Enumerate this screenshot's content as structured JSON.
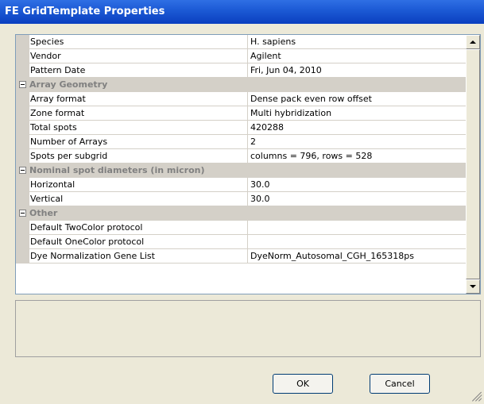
{
  "window": {
    "title": "FE GridTemplate Properties"
  },
  "grid": {
    "rows": [
      {
        "kind": "prop",
        "name": "Species",
        "value": "H. sapiens"
      },
      {
        "kind": "prop",
        "name": "Vendor",
        "value": "Agilent"
      },
      {
        "kind": "prop",
        "name": "Pattern Date",
        "value": "Fri, Jun 04, 2010"
      },
      {
        "kind": "category",
        "name": "Array Geometry"
      },
      {
        "kind": "prop",
        "name": "Array format",
        "value": "Dense pack even row offset"
      },
      {
        "kind": "prop",
        "name": "Zone format",
        "value": "Multi hybridization"
      },
      {
        "kind": "prop",
        "name": "Total spots",
        "value": "420288"
      },
      {
        "kind": "prop",
        "name": "Number of Arrays",
        "value": "2"
      },
      {
        "kind": "prop",
        "name": "Spots per subgrid",
        "value": "columns = 796,  rows = 528"
      },
      {
        "kind": "category",
        "name": "Nominal spot diameters (in micron)"
      },
      {
        "kind": "prop",
        "name": "Horizontal",
        "value": "30.0"
      },
      {
        "kind": "prop",
        "name": "Vertical",
        "value": "30.0"
      },
      {
        "kind": "category",
        "name": "Other"
      },
      {
        "kind": "prop",
        "name": "Default TwoColor protocol",
        "value": ""
      },
      {
        "kind": "prop",
        "name": "Default OneColor protocol",
        "value": ""
      },
      {
        "kind": "prop",
        "name": "Dye Normalization Gene List",
        "value": "DyeNorm_Autosomal_CGH_165318ps"
      }
    ]
  },
  "buttons": {
    "ok": "OK",
    "cancel": "Cancel"
  },
  "icons": {
    "category_toggle": "minus-box-icon",
    "scroll_up": "up-arrow-icon",
    "scroll_down": "down-arrow-icon"
  },
  "colors": {
    "titlebar": "#1d5bd6",
    "face": "#ece9d8",
    "grid_line": "#d4d0c8",
    "category_text": "#808080"
  }
}
